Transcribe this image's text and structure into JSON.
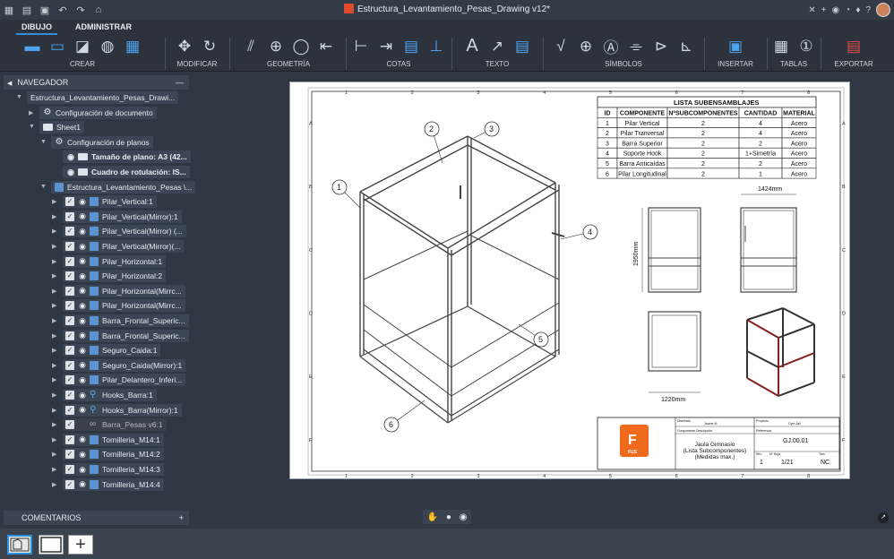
{
  "app": {
    "title": "Estructura_Levantamiento_Pesas_Drawing v12*"
  },
  "ribbon": {
    "tabs": [
      "DIBUJO",
      "ADMINISTRAR"
    ],
    "groups": [
      "CREAR",
      "MODIFICAR",
      "GEOMETRÍA",
      "COTAS",
      "TEXTO",
      "SÍMBOLOS",
      "INSERTAR",
      "TABLAS",
      "EXPORTAR"
    ]
  },
  "navigator": {
    "title": "NAVEGADOR",
    "items": [
      {
        "label": "Estructura_Levantamiento_Pesas_Drawi...",
        "indent": 0
      },
      {
        "label": "Configuración de documento",
        "indent": 1
      },
      {
        "label": "Sheet1",
        "indent": 1
      },
      {
        "label": "Configuración de planos",
        "indent": 2
      },
      {
        "label": "Tamaño de plano: A3 (42...",
        "indent": 3
      },
      {
        "label": "Cuadro de rotulación: IS...",
        "indent": 3
      },
      {
        "label": "Estructura_Levantamiento_Pesas \\...",
        "indent": 2
      },
      {
        "label": "Pilar_Vertical:1",
        "indent": 3
      },
      {
        "label": "Pilar_Vertical(Mirror):1",
        "indent": 3
      },
      {
        "label": "Pilar_Vertical(Mirror) (...",
        "indent": 3
      },
      {
        "label": "Pilar_Vertical(Mirror)(...",
        "indent": 3
      },
      {
        "label": "Pilar_Horizontal:1",
        "indent": 3
      },
      {
        "label": "Pilar_Horizontal:2",
        "indent": 3
      },
      {
        "label": "Pilar_Horizontal(Mirrc...",
        "indent": 3
      },
      {
        "label": "Pilar_Horizontal(Mirrc...",
        "indent": 3
      },
      {
        "label": "Barra_Frontal_Superic...",
        "indent": 3
      },
      {
        "label": "Barra_Frontal_Superic...",
        "indent": 3
      },
      {
        "label": "Seguro_Caida:1",
        "indent": 3
      },
      {
        "label": "Seguro_Caida(Mirror):1",
        "indent": 3
      },
      {
        "label": "Pilar_Delantero_Inferi...",
        "indent": 3
      },
      {
        "label": "Hooks_Barra:1",
        "indent": 3
      },
      {
        "label": "Hooks_Barra(Mirror):1",
        "indent": 3
      },
      {
        "label": "Barra_Pesas v6:1",
        "indent": 3
      },
      {
        "label": "Tornilleria_M14:1",
        "indent": 3
      },
      {
        "label": "Tornilleria_M14:2",
        "indent": 3
      },
      {
        "label": "Tornilleria_M14:3",
        "indent": 3
      },
      {
        "label": "Tornilleria_M14:4",
        "indent": 3
      }
    ]
  },
  "comments": {
    "title": "COMENTARIOS"
  },
  "drawing": {
    "table_title": "LISTA SUBENSAMBLAJES",
    "headers": [
      "ID",
      "COMPONENTE",
      "NºSUBCOMPONENTES",
      "CANTIDAD",
      "MATERIAL"
    ],
    "rows": [
      [
        "1",
        "Pilar Vertical",
        "2",
        "4",
        "Acero"
      ],
      [
        "2",
        "Pilar Tranversal",
        "2",
        "4",
        "Acero"
      ],
      [
        "3",
        "Barra Superior",
        "2",
        "2",
        "Acero"
      ],
      [
        "4",
        "Soporte Hook",
        "2",
        "1+Simetría",
        "Acero"
      ],
      [
        "5",
        "Barra Anticaídas",
        "2",
        "2",
        "Acero"
      ],
      [
        "6",
        "Pilar Longitudinal",
        "2",
        "1",
        "Acero"
      ]
    ],
    "dims": {
      "width": "1424mm",
      "height": "1950mm",
      "depth": "1220mm"
    },
    "balloons": [
      "1",
      "2",
      "3",
      "4",
      "5",
      "6"
    ],
    "col_labels": [
      "1",
      "2",
      "3",
      "4",
      "5",
      "6",
      "7",
      "8"
    ],
    "row_labels": [
      "A",
      "B",
      "C",
      "D",
      "E",
      "F"
    ],
    "title_block": {
      "logo": "FUS",
      "logo_letter": "F",
      "designed_label": "Diseñado",
      "designed": "Jaume M.",
      "project_label": "Proyecto",
      "project": "Gym Jail",
      "desc_label": "Componente Descripción",
      "description": "Jaula Gimnasio\n(Lista Subcomponentes)\n(Medidas max.)",
      "ref_label": "Referencia",
      "reference": "GJ.00.01",
      "sheet_label": "Rev",
      "sheet_val": "1",
      "page_label": "Nº Hoja",
      "page": "1/21",
      "size_label": "Tam",
      "size": "NC"
    }
  }
}
